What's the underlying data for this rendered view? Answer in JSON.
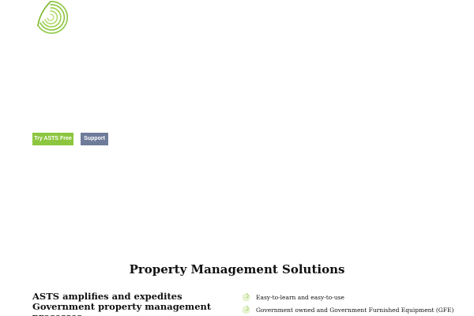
{
  "colors": {
    "brand_green": "#8cc63f",
    "support_slate": "#6e7b9a",
    "text": "#111111"
  },
  "header": {
    "logo_icon": "asts-spiral-logo-icon"
  },
  "hero": {
    "try_button_label": "Try ASTS Free",
    "support_button_label": "Support"
  },
  "solutions": {
    "title": "Property Management Solutions",
    "intro": "ASTS amplifies and expedites Government property management processes.",
    "features": [
      {
        "icon": "green-swirl-bullet-icon",
        "label": "Easy-to-learn and easy-to-use"
      },
      {
        "icon": "green-swirl-bullet-icon",
        "label": "Government owned and Government Furnished Equipment (GFE)"
      }
    ]
  }
}
